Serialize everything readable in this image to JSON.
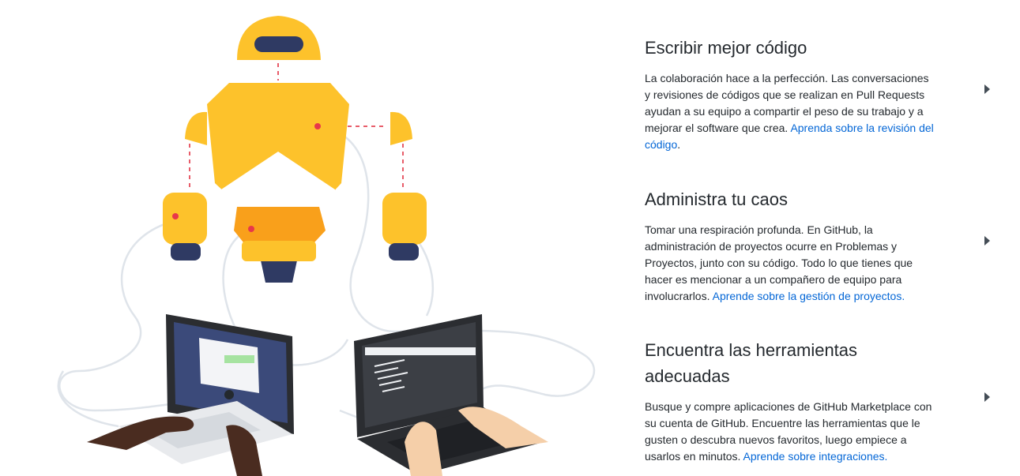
{
  "features": [
    {
      "title": "Escribir mejor código",
      "body": "La colaboración hace a la perfección. Las conversaciones y revisiones de códigos que se realizan en Pull Requests ayudan a su equipo a compartir el peso de su trabajo y a mejorar el software que crea.",
      "link": "Aprenda sobre la revisión del código",
      "tail": ".",
      "expand_icon": "caret-right-icon"
    },
    {
      "title": "Administra tu caos",
      "body": "Tomar una respiración profunda. En GitHub, la administración de proyectos ocurre en Problemas y Proyectos, junto con su código. Todo lo que tienes que hacer es mencionar a un compañero de equipo para involucrarlos.",
      "link": "Aprende sobre la gestión de proyectos.",
      "tail": "",
      "expand_icon": "caret-right-icon"
    },
    {
      "title": "Encuentra las herramientas adecuadas",
      "body": "Busque y compre aplicaciones de GitHub Marketplace con su cuenta de GitHub. Encuentre las herramientas que le gusten o descubra nuevos favoritos, luego empiece a usarlos en minutos.",
      "link": "Aprende sobre integraciones.",
      "tail": "",
      "expand_icon": "caret-right-icon"
    }
  ],
  "colors": {
    "link": "#0366d6",
    "robot_yellow": "#fdc22b",
    "robot_orange": "#f9a01b",
    "robot_navy": "#2f3a63",
    "laptop_dark": "#2b2d31",
    "laptop_light": "#e8eaed"
  }
}
